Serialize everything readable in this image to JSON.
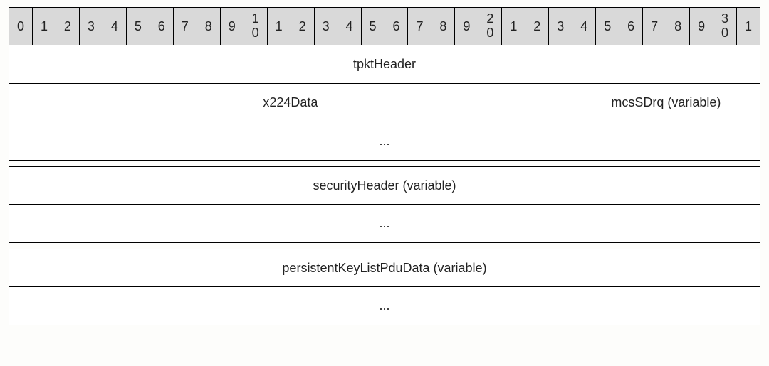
{
  "bits": {
    "count": 32,
    "tens_at": [
      10,
      20,
      30
    ]
  },
  "rows": [
    {
      "kind": "full",
      "label": "tpktHeader"
    },
    {
      "kind": "split",
      "left": "x224Data",
      "right": "mcsSDrq (variable)"
    },
    {
      "kind": "full",
      "label": "..."
    },
    {
      "kind": "gap"
    },
    {
      "kind": "full",
      "label": "securityHeader (variable)"
    },
    {
      "kind": "full",
      "label": "..."
    },
    {
      "kind": "gap"
    },
    {
      "kind": "full",
      "label": "persistentKeyListPduData (variable)"
    },
    {
      "kind": "full",
      "label": "..."
    }
  ]
}
